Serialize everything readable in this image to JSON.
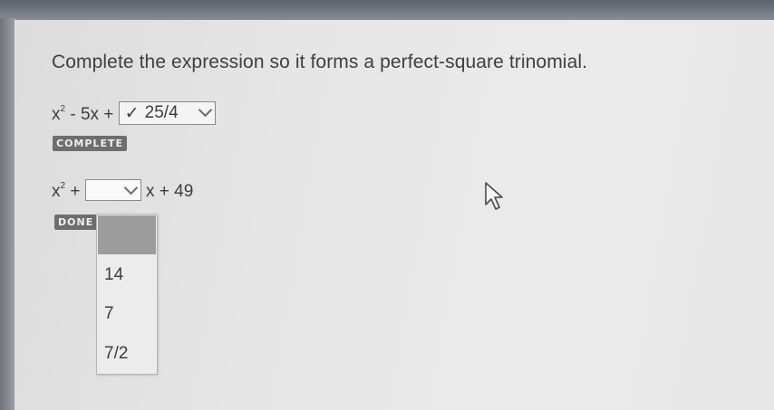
{
  "question": {
    "prompt": "Complete the expression so it forms a perfect-square trinomial."
  },
  "problem1": {
    "expr_x": "x",
    "expr_exp": "2",
    "expr_middle": " - 5x + ",
    "selected_value": "25/4",
    "status_badge": "COMPLETE",
    "check_glyph": "✓"
  },
  "problem2": {
    "expr_x": "x",
    "expr_exp": "2",
    "expr_plus": " + ",
    "expr_after": " x + 49",
    "status_badge": "DONE",
    "dropdown_options": [
      "14",
      "7",
      "7/2"
    ]
  },
  "colors": {
    "panel": "#e8e8e8",
    "badge": "#6e6e6e",
    "dropdown_highlight": "#9d9d9d"
  },
  "icons": [
    "chevron-down-icon",
    "check-icon",
    "mouse-cursor-icon"
  ]
}
